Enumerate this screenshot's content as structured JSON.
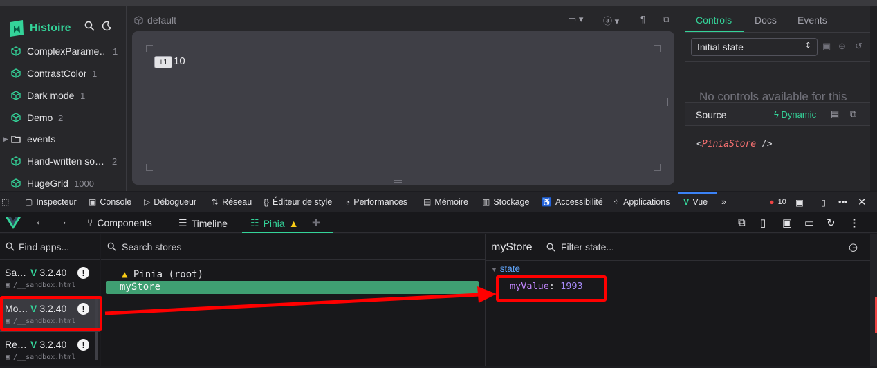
{
  "histoire": {
    "logo_text": "Histoire",
    "stories": [
      {
        "name": "ComplexParame…",
        "count": "1"
      },
      {
        "name": "ContrastColor",
        "count": "1"
      },
      {
        "name": "Dark mode",
        "count": "1"
      },
      {
        "name": "Demo",
        "count": "2"
      },
      {
        "name": "events",
        "count": ""
      },
      {
        "name": "Hand-written so…",
        "count": "2"
      },
      {
        "name": "HugeGrid",
        "count": "1000"
      }
    ],
    "variant_title": "default",
    "preview": {
      "increment_label": "+1",
      "count_value": "10"
    },
    "right_tabs": [
      "Controls",
      "Docs",
      "Events"
    ],
    "state_select": "Initial state",
    "no_controls_text": "No controls available for this",
    "source_title": "Source",
    "dynamic_label": "Dynamic",
    "source_code_open": "<",
    "source_code_tag": "PiniaStore",
    "source_code_close": " />"
  },
  "devtools_toolbar": {
    "tabs": [
      "Inspecteur",
      "Console",
      "Débogueur",
      "Réseau",
      "Éditeur de style",
      "Performances",
      "Mémoire",
      "Stockage",
      "Accessibilité",
      "Applications",
      "Vue"
    ],
    "error_count": "10"
  },
  "vue_devtools": {
    "nav": {
      "components": "Components",
      "timeline": "Timeline",
      "pinia": "Pinia"
    },
    "apps_search_placeholder": "Find apps...",
    "apps": [
      {
        "name": "Sa…",
        "version": "3.2.40",
        "path": "/__sandbox.html"
      },
      {
        "name": "Mo…",
        "version": "3.2.40",
        "path": "/__sandbox.html"
      },
      {
        "name": "Re…",
        "version": "3.2.40",
        "path": "/__sandbox.html"
      }
    ],
    "stores_search_placeholder": "Search stores",
    "tree": {
      "root": "Pinia (root)",
      "selected": "myStore"
    },
    "state_panel": {
      "title": "myStore",
      "filter_placeholder": "Filter state...",
      "section": "state",
      "key": "myValue",
      "value": "1993"
    }
  },
  "colors": {
    "accent": "#34d399",
    "annotation": "#ff0000",
    "selection": "#3f9f72"
  }
}
